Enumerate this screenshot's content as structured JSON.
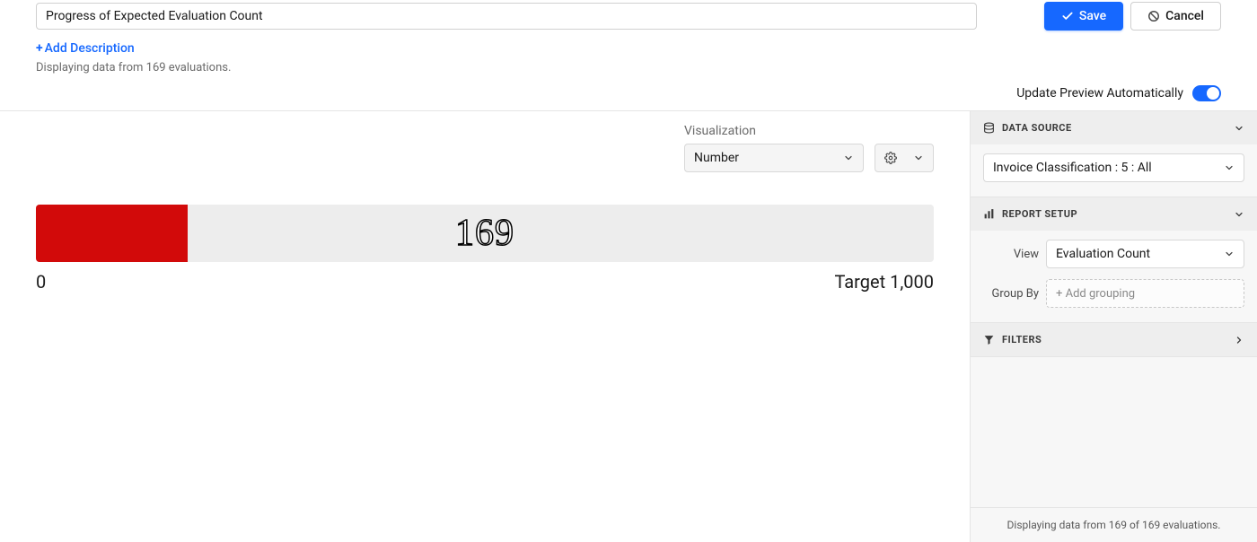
{
  "header": {
    "title_value": "Progress of Expected Evaluation Count",
    "save_label": "Save",
    "cancel_label": "Cancel",
    "add_description_label": "Add Description",
    "displaying_text": "Displaying data from 169 evaluations.",
    "auto_preview_label": "Update Preview Automatically"
  },
  "viz_controls": {
    "label": "Visualization",
    "selected": "Number"
  },
  "chart_data": {
    "type": "bar",
    "value": 169,
    "min": 0,
    "target": 1000,
    "min_label": "0",
    "target_label": "Target 1,000",
    "value_display": "169",
    "fill_color": "#d20a0a",
    "track_color": "#ededed"
  },
  "sidebar": {
    "data_source": {
      "title": "DATA SOURCE",
      "selected": "Invoice Classification : 5 : All"
    },
    "report_setup": {
      "title": "REPORT SETUP",
      "view_label": "View",
      "view_selected": "Evaluation Count",
      "group_by_label": "Group By",
      "group_by_placeholder": "+ Add grouping"
    },
    "filters": {
      "title": "FILTERS"
    },
    "footer_text": "Displaying data from 169 of 169 evaluations."
  }
}
